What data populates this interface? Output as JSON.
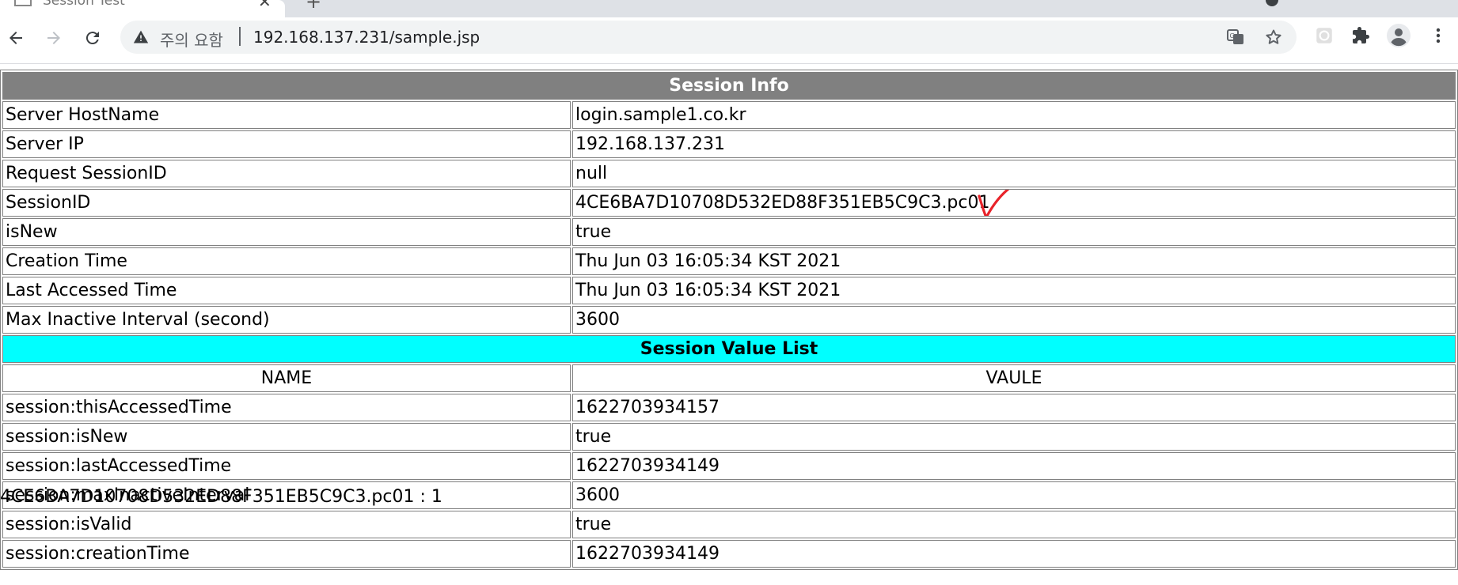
{
  "browser": {
    "tab_title": "Session Test",
    "address": {
      "security_label": "주의 요함",
      "url": "192.168.137.231/sample.jsp"
    }
  },
  "session_info": {
    "title": "Session Info",
    "rows": [
      {
        "label": "Server HostName",
        "value": "login.sample1.co.kr"
      },
      {
        "label": "Server IP",
        "value": "192.168.137.231"
      },
      {
        "label": "Request SessionID",
        "value": "null"
      },
      {
        "label": "SessionID",
        "value": "4CE6BA7D10708D532ED88F351EB5C9C3.pc01"
      },
      {
        "label": "isNew",
        "value": "true"
      },
      {
        "label": "Creation Time",
        "value": "Thu Jun 03 16:05:34 KST 2021"
      },
      {
        "label": "Last Accessed Time",
        "value": "Thu Jun 03 16:05:34 KST 2021"
      },
      {
        "label": "Max Inactive Interval (second)",
        "value": "3600"
      }
    ]
  },
  "session_values": {
    "title": "Session Value List",
    "col_name": "NAME",
    "col_value": "VAULE",
    "rows": [
      {
        "name": "session:thisAccessedTime",
        "value": "1622703934157"
      },
      {
        "name": "session:isNew",
        "value": "true"
      },
      {
        "name": "session:lastAccessedTime",
        "value": "1622703934149"
      },
      {
        "name": "session:maxInactiveInterval",
        "value": "3600"
      },
      {
        "name": "session:isValid",
        "value": "true"
      },
      {
        "name": "session:creationTime",
        "value": "1622703934149"
      }
    ]
  },
  "footer": {
    "text": "4CE6BA7D10708D532ED88F351EB5C9C3.pc01 : 1"
  },
  "colors": {
    "header_gray": "#808080",
    "header_cyan": "#00ffff",
    "annotation_red": "#e8232a"
  }
}
